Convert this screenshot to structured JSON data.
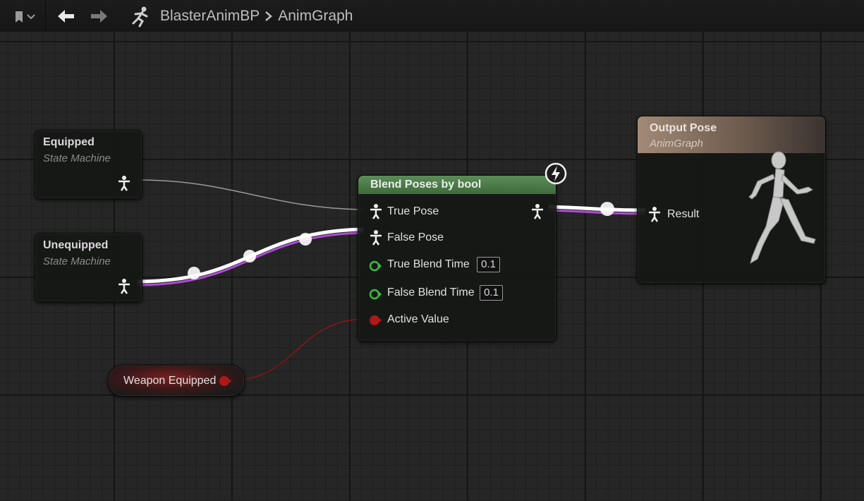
{
  "toolbar": {
    "breadcrumb": [
      "BlasterAnimBP",
      "AnimGraph"
    ],
    "icons": {
      "bookmark": "bookmark-icon",
      "back": "arrow-left-icon",
      "forward": "arrow-right-icon",
      "graph": "running-figure-icon"
    }
  },
  "nodes": {
    "equipped": {
      "title": "Equipped",
      "subtitle": "State Machine"
    },
    "unequipped": {
      "title": "Unequipped",
      "subtitle": "State Machine"
    },
    "blend": {
      "title": "Blend Poses by bool",
      "true_pose": "True Pose",
      "false_pose": "False Pose",
      "true_blend_time": "True Blend Time",
      "true_blend_value": "0.1",
      "false_blend_time": "False Blend Time",
      "false_blend_value": "0.1",
      "active_value": "Active Value"
    },
    "output": {
      "title": "Output Pose",
      "subtitle": "AnimGraph",
      "result": "Result"
    },
    "weapon": {
      "label": "Weapon Equipped"
    }
  },
  "colors": {
    "blend_header": "#4f7a4c",
    "output_header": "#8c7563",
    "bool_pin": "#b01818",
    "float_pin": "#35c13a",
    "pose_wire_accent": "#b24ad6"
  }
}
